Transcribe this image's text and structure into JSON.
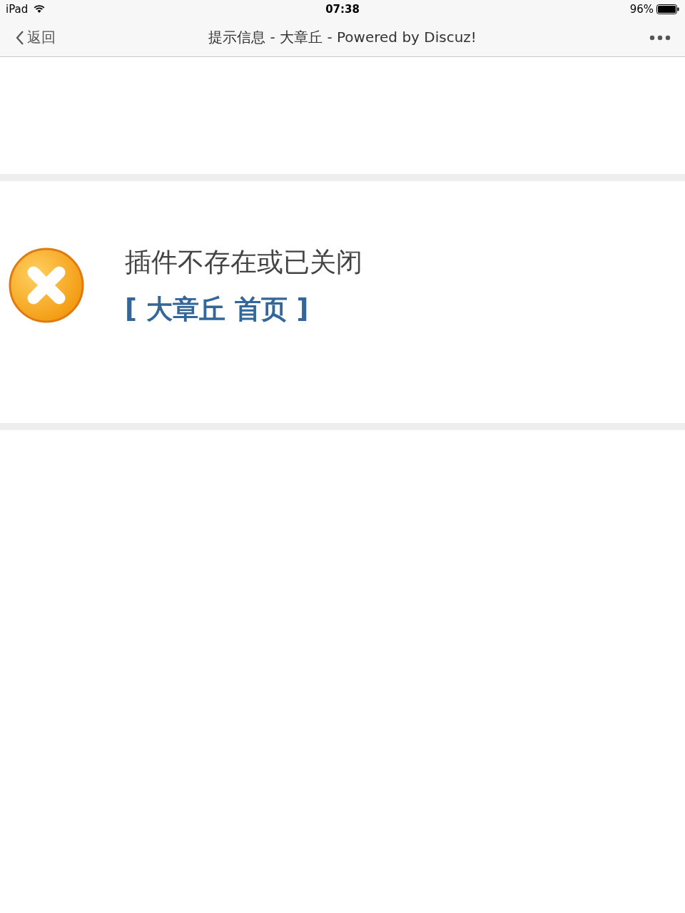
{
  "status_bar": {
    "device": "iPad",
    "time": "07:38",
    "battery": "96%"
  },
  "nav_bar": {
    "back": "返回",
    "title": "提示信息 - 大章丘 - Powered by Discuz!"
  },
  "message": {
    "text": "插件不存在或已关闭",
    "link": "[ 大章丘 首页 ]"
  }
}
